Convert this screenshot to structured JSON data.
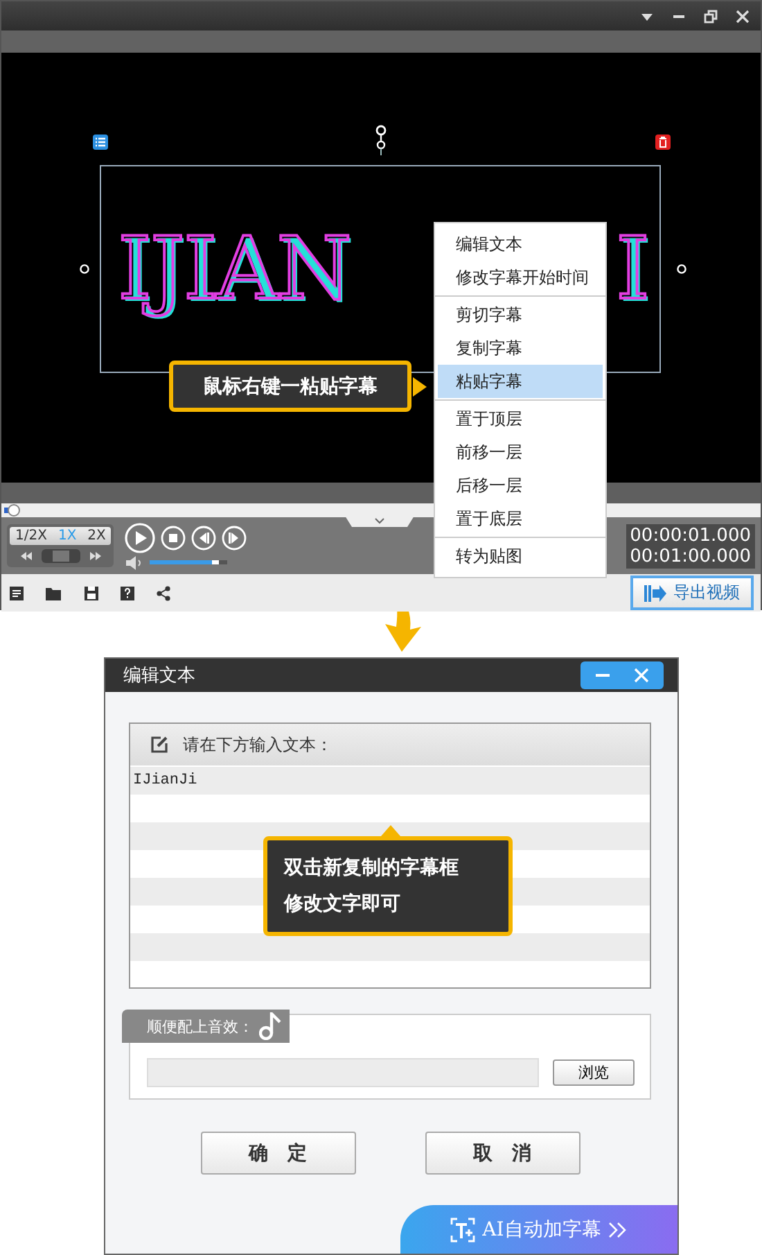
{
  "video": {
    "caption_parts": [
      "IJIAN",
      "I"
    ]
  },
  "hint": "鼠标右键一粘贴字幕",
  "context_menu": {
    "groups": [
      [
        {
          "label": "编辑文本",
          "selected": false
        },
        {
          "label": "修改字幕开始时间",
          "selected": false
        }
      ],
      [
        {
          "label": "剪切字幕",
          "selected": false
        },
        {
          "label": "复制字幕",
          "selected": false
        },
        {
          "label": "粘贴字幕",
          "selected": true
        }
      ],
      [
        {
          "label": "置于顶层",
          "selected": false
        },
        {
          "label": "前移一层",
          "selected": false
        },
        {
          "label": "后移一层",
          "selected": false
        },
        {
          "label": "置于底层",
          "selected": false
        }
      ],
      [
        {
          "label": "转为贴图",
          "selected": false
        }
      ]
    ]
  },
  "player": {
    "progress": {
      "level": 0.01
    },
    "speeds": [
      {
        "label": "1/2X",
        "selected": false
      },
      {
        "label": "1X",
        "selected": true
      },
      {
        "label": "2X",
        "selected": false
      }
    ],
    "volume": {
      "level": 0.88
    },
    "times": [
      "00:00:01.000",
      "00:01:00.000"
    ],
    "export_button": "导出视频"
  },
  "dialog": {
    "title": "编辑文本",
    "prompt": "请在下方输入文本：",
    "lines": [
      "IJianJi"
    ],
    "hint_lines": [
      "双击新复制的字幕框",
      "修改文字即可"
    ],
    "sound_label": "顺便配上音效：",
    "browse_button": "浏览",
    "ok_button": "确　定",
    "cancel_button": "取　消",
    "banner": "AI自动加字幕"
  }
}
